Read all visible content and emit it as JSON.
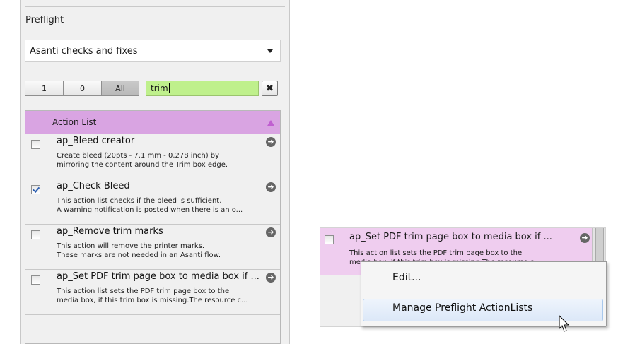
{
  "panel": {
    "title": "Preflight",
    "profile_dropdown": "Asanti checks and fixes",
    "filter_buttons": [
      "1",
      "0",
      "All"
    ],
    "search_value": "trim",
    "clear_label": "✖"
  },
  "action_list": {
    "header": "Action List",
    "rows": [
      {
        "name": "ap_Bleed creator",
        "desc1": "Create bleed (20pts - 7.1 mm - 0.278 inch) by",
        "desc2": "mirroring the content around the Trim box edge.",
        "checked": false
      },
      {
        "name": "ap_Check Bleed",
        "desc1": "This action list checks if the bleed is sufficient.",
        "desc2": "A warning notification is posted when there is an o...",
        "checked": true
      },
      {
        "name": "ap_Remove trim marks",
        "desc1": "This action will remove the printer marks.",
        "desc2": "These marks are not needed in an Asanti flow.",
        "checked": false
      },
      {
        "name": "ap_Set PDF trim page box to media box if ...",
        "desc1": "This action list sets the PDF trim page box to the",
        "desc2": "media box, if this trim box is missing.The resource c...",
        "checked": false
      }
    ]
  },
  "context_snippet": {
    "row_name": "ap_Set PDF trim page box to media box if ...",
    "row_desc1": "This action list sets the PDF trim page box to the",
    "row_desc2": "media box, if this trim box is missing.The resource c",
    "menu": {
      "edit": "Edit...",
      "manage": "Manage Preflight ActionLists"
    }
  },
  "colors": {
    "header_purple": "#d9a4e2",
    "search_green": "#bff08c",
    "highlight_row": "#efcdef"
  }
}
